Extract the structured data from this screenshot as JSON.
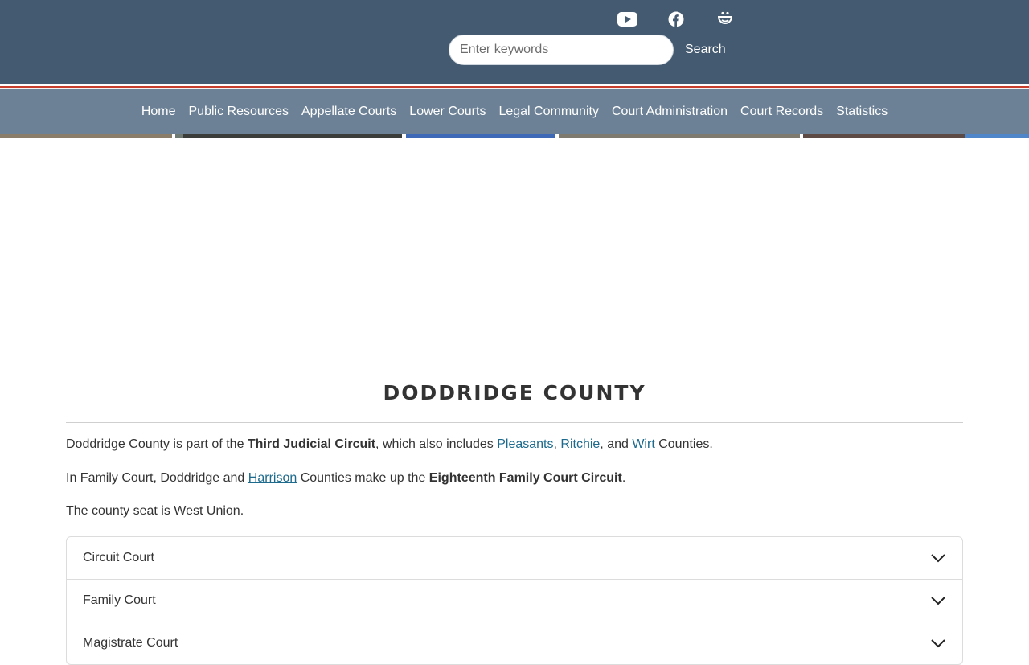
{
  "header": {
    "social": [
      {
        "icon": "youtube-icon"
      },
      {
        "icon": "facebook-icon"
      },
      {
        "icon": "smile-icon"
      }
    ],
    "search": {
      "placeholder": "Enter keywords",
      "value": "",
      "button_label": "Search"
    }
  },
  "nav": {
    "items": [
      {
        "label": "Home"
      },
      {
        "label": "Public Resources"
      },
      {
        "label": "Appellate Courts"
      },
      {
        "label": "Lower Courts"
      },
      {
        "label": "Legal Community"
      },
      {
        "label": "Court Administration"
      },
      {
        "label": "Court Records"
      },
      {
        "label": "Statistics"
      }
    ]
  },
  "main": {
    "title": "DODDRIDGE COUNTY",
    "para1": {
      "t1": "Doddridge County is part of the ",
      "b1": "Third Judicial Circuit",
      "t2": ", which also includes ",
      "l1": "Pleasants",
      "t3": ", ",
      "l2": "Ritchie",
      "t4": ", and ",
      "l3": "Wirt",
      "t5": " Counties."
    },
    "para2": {
      "t1": "In Family Court, Doddridge and ",
      "l1": "Harrison",
      "t2": " Counties make up the ",
      "b1": "Eighteenth Family Court Circuit",
      "t3": "."
    },
    "para3": "The county seat is West Union.",
    "accordion": [
      {
        "label": "Circuit Court"
      },
      {
        "label": "Family Court"
      },
      {
        "label": "Magistrate Court"
      }
    ]
  },
  "colors": {
    "header_bg": "#435a70",
    "nav_bg": "#6c8196",
    "accent_red": "#c8402d",
    "link": "#1d6a8d"
  }
}
